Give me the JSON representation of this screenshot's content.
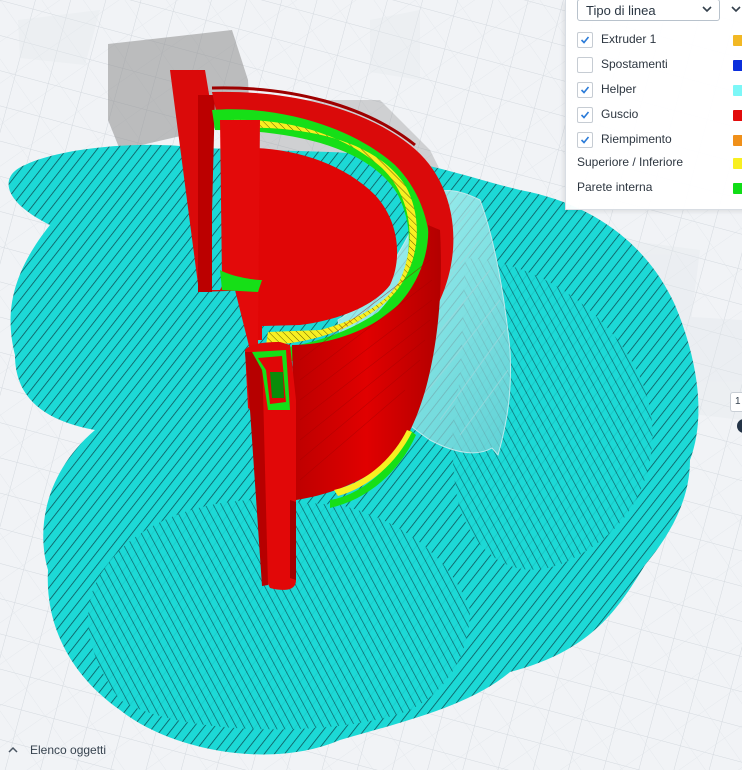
{
  "legend_panel": {
    "dropdown_value": "Tipo di linea",
    "items": [
      {
        "label": "Extruder 1",
        "checked": true,
        "color": "#f2b824"
      },
      {
        "label": "Spostamenti",
        "checked": false,
        "color": "#0b2fdc"
      },
      {
        "label": "Helper",
        "checked": true,
        "color": "#7cf7f7"
      },
      {
        "label": "Guscio",
        "checked": true,
        "color": "#e20b0b"
      },
      {
        "label": "Riempimento",
        "checked": true,
        "color": "#f09019"
      },
      {
        "label": "Superiore / Inferiore",
        "checked": null,
        "color": "#f8ef21"
      },
      {
        "label": "Parete interna",
        "checked": null,
        "color": "#11dd17"
      }
    ]
  },
  "bottom_bar": {
    "label": "Elenco oggetti",
    "icon": "chevron-up-icon"
  },
  "side_controls": {
    "badge_text": "1"
  },
  "colors": {
    "accent": "#2b7bd8",
    "helper": "#1ed7d7",
    "shell": "#e20b0b",
    "inner_wall": "#11dd17",
    "top_bottom": "#f8ef21",
    "shadow": "#8c8c8c"
  }
}
